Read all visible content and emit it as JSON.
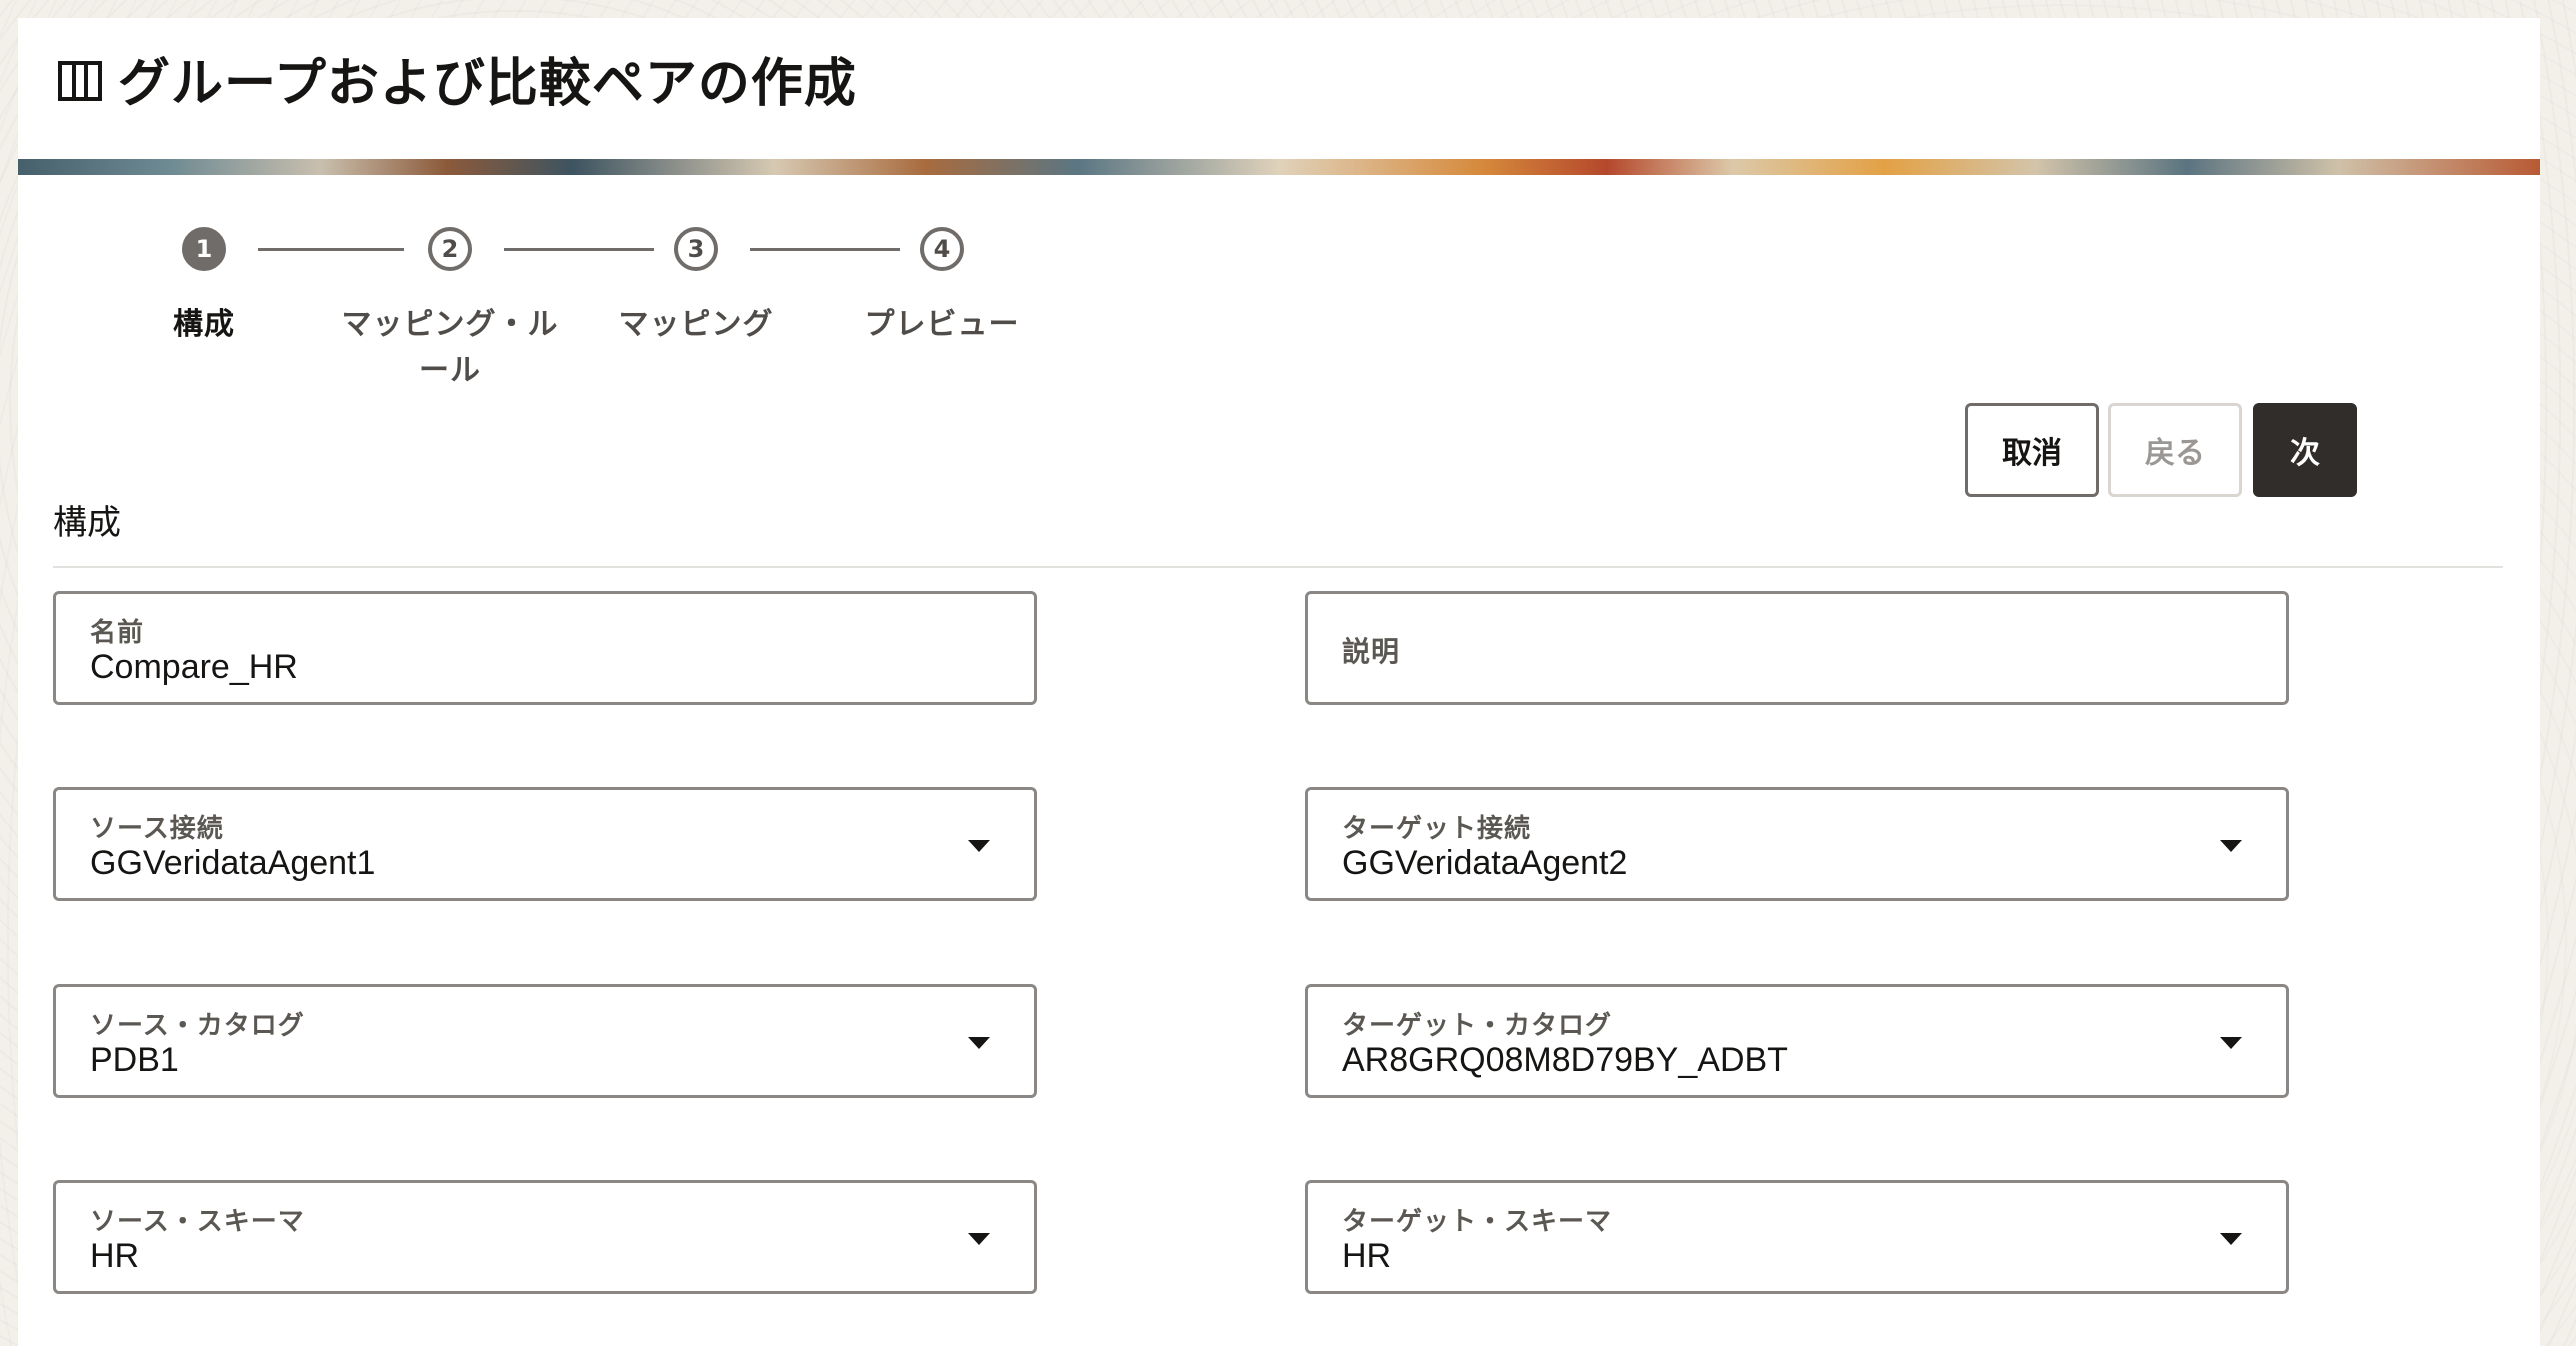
{
  "page": {
    "title": "グループおよび比較ペアの作成",
    "icon": "columns-icon"
  },
  "steps": [
    {
      "number": "1",
      "label": "構成",
      "active": true
    },
    {
      "number": "2",
      "label": "マッピング・ル",
      "label2": "ール",
      "active": false
    },
    {
      "number": "3",
      "label": "マッピング",
      "active": false
    },
    {
      "number": "4",
      "label": "プレビュー",
      "active": false
    }
  ],
  "buttons": {
    "cancel": "取消",
    "back": "戻る",
    "next": "次"
  },
  "section": {
    "title": "構成"
  },
  "form": {
    "name": {
      "label": "名前",
      "value": "Compare_HR"
    },
    "description": {
      "label": "説明",
      "value": ""
    },
    "source_connection": {
      "label": "ソース接続",
      "value": "GGVeridataAgent1"
    },
    "target_connection": {
      "label": "ターゲット接続",
      "value": "GGVeridataAgent2"
    },
    "source_catalog": {
      "label": "ソース・カタログ",
      "value": "PDB1"
    },
    "target_catalog": {
      "label": "ターゲット・カタログ",
      "value": "AR8GRQ08M8D79BY_ADBT"
    },
    "source_schema": {
      "label": "ソース・スキーマ",
      "value": "HR"
    },
    "target_schema": {
      "label": "ターゲット・スキーマ",
      "value": "HR"
    }
  }
}
